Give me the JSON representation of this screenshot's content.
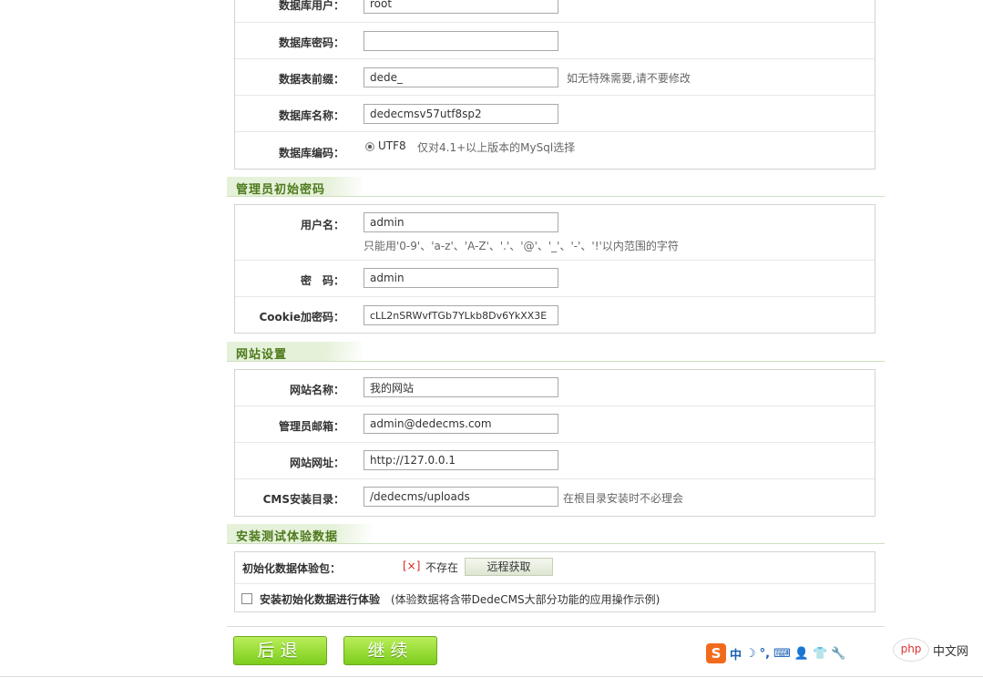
{
  "db": {
    "user_label": "数据库用户：",
    "user_value": "root",
    "pass_label": "数据库密码：",
    "pass_value": "",
    "prefix_label": "数据表前缀：",
    "prefix_value": "dede_",
    "prefix_hint": "如无特殊需要,请不要修改",
    "name_label": "数据库名称：",
    "name_value": "dedecmsv57utf8sp2",
    "charset_label": "数据库编码：",
    "charset_option": "UTF8",
    "charset_hint": "仅对4.1+以上版本的MySql选择"
  },
  "admin": {
    "section_title": "管理员初始密码",
    "username_label": "用户名：",
    "username_value": "admin",
    "username_hint": "只能用'0-9'、'a-z'、'A-Z'、'.'、'@'、'_'、'-'、'!'以内范围的字符",
    "password_label": "密　码：",
    "password_value": "admin",
    "cookie_label": "Cookie加密码：",
    "cookie_value": "cLL2nSRWvfTGb7YLkb8Dv6YkXX3E"
  },
  "site": {
    "section_title": "网站设置",
    "name_label": "网站名称：",
    "name_value": "我的网站",
    "email_label": "管理员邮箱：",
    "email_value": "admin@dedecms.com",
    "url_label": "网站网址：",
    "url_value": "http://127.0.0.1",
    "dir_label": "CMS安装目录：",
    "dir_value": "/dedecms/uploads",
    "dir_hint": "在根目录安装时不必理会"
  },
  "demo": {
    "section_title": "安装测试体验数据",
    "package_label": "初始化数据体验包：",
    "status_mark": "[×]",
    "status_text": "不存在",
    "fetch_button": "远程获取",
    "install_label": "安装初始化数据进行体验",
    "install_hint": "(体验数据将含带DedeCMS大部分功能的应用操作示例)"
  },
  "buttons": {
    "back": "后退",
    "next": "继续"
  },
  "ime": {
    "mode": "中"
  },
  "watermark": {
    "logo": "php",
    "text": "中文网"
  }
}
